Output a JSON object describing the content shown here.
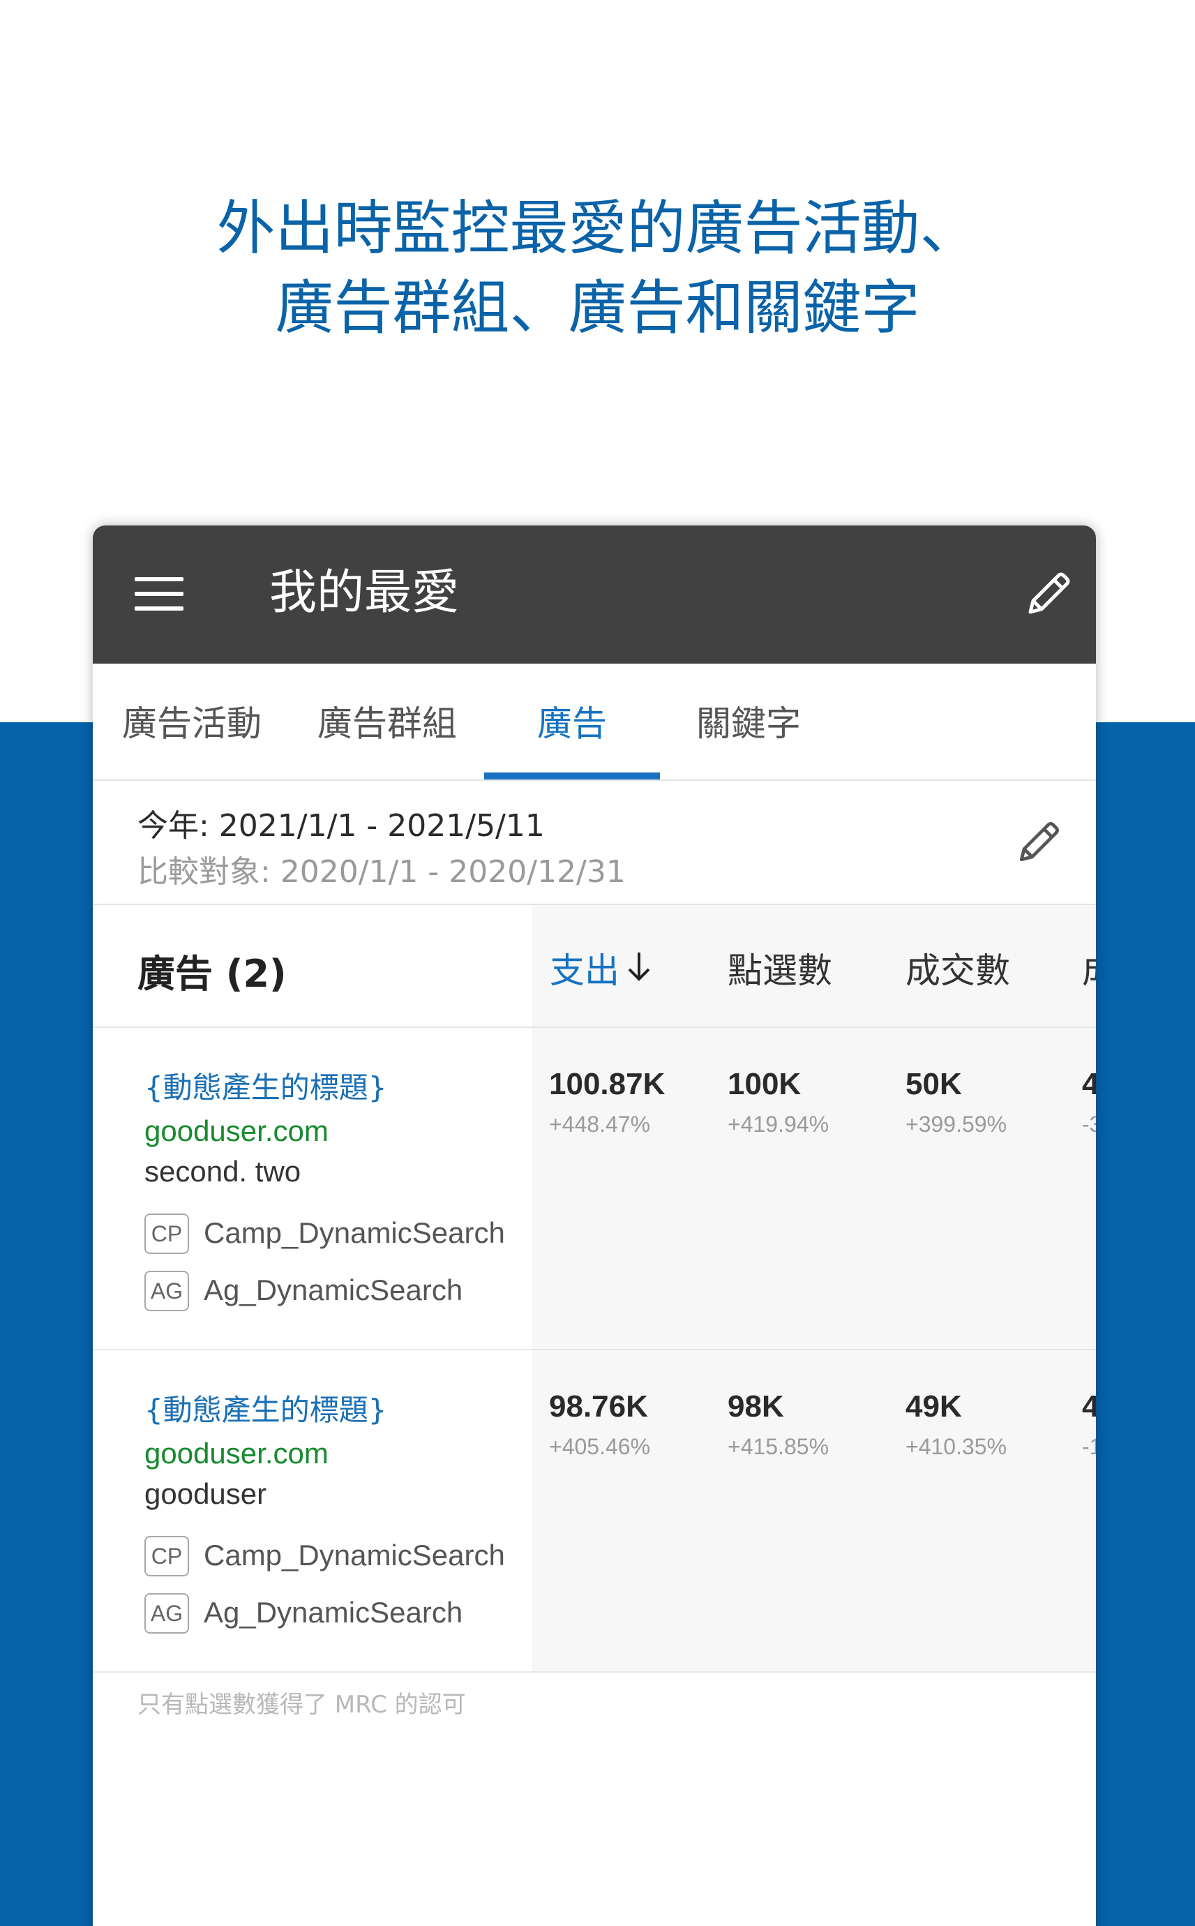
{
  "headline": {
    "line1": "外出時監控最愛的廣告活動、",
    "line2": "廣告群組、廣告和關鍵字"
  },
  "appbar": {
    "title": "我的最愛",
    "menu_icon": "hamburger-menu-icon",
    "edit_icon": "pencil-icon"
  },
  "tabs": [
    {
      "label": "廣告活動",
      "active": false
    },
    {
      "label": "廣告群組",
      "active": false
    },
    {
      "label": "廣告",
      "active": true
    },
    {
      "label": "關鍵字",
      "active": false
    }
  ],
  "date_range": {
    "current": "今年: 2021/1/1 - 2021/5/11",
    "compare": "比較對象: 2020/1/1 -  2020/12/31"
  },
  "list": {
    "title": "廣告 (2)",
    "columns": [
      "支出",
      "點選數",
      "成交數",
      "成"
    ],
    "sorted_column": "支出",
    "sort_direction": "descending",
    "rows": [
      {
        "title": "{動態產生的標題}",
        "url": "gooduser.com",
        "description": "second. two",
        "campaign_tag": "CP",
        "campaign": "Camp_DynamicSearch",
        "adgroup_tag": "AG",
        "adgroup": "Ag_DynamicSearch",
        "metrics": [
          {
            "value": "100.87K",
            "change": "+448.47%"
          },
          {
            "value": "100K",
            "change": "+419.94%"
          },
          {
            "value": "50K",
            "change": "+399.59%"
          },
          {
            "value": "4",
            "change": "-3"
          }
        ]
      },
      {
        "title": "{動態產生的標題}",
        "url": "gooduser.com",
        "description": "gooduser",
        "campaign_tag": "CP",
        "campaign": "Camp_DynamicSearch",
        "adgroup_tag": "AG",
        "adgroup": "Ag_DynamicSearch",
        "metrics": [
          {
            "value": "98.76K",
            "change": "+405.46%"
          },
          {
            "value": "98K",
            "change": "+415.85%"
          },
          {
            "value": "49K",
            "change": "+410.35%"
          },
          {
            "value": "4",
            "change": "-1"
          }
        ]
      }
    ]
  },
  "footnote": "只有點選數獲得了 MRC 的認可",
  "colors": {
    "brand_blue": "#0662a9",
    "accent": "#1673c2",
    "appbar": "#414141",
    "url_green": "#178a2f"
  }
}
